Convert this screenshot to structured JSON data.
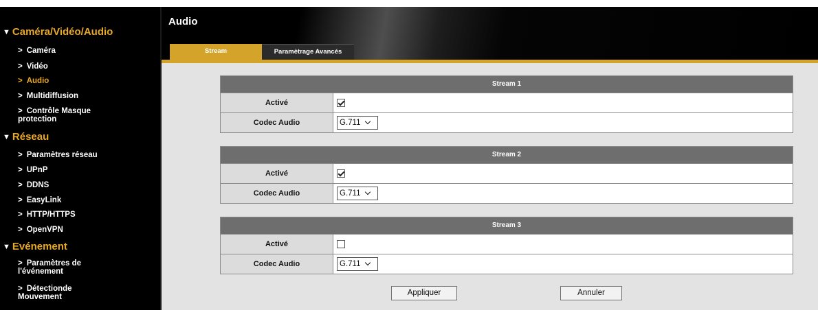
{
  "header": {
    "title": "Audio"
  },
  "tabs": [
    {
      "label": "Stream",
      "active": true
    },
    {
      "label": "Paramètrage Avancés",
      "active": false
    }
  ],
  "sidebar": {
    "sections": [
      {
        "label": "Caméra/Vidéo/Audio",
        "items": [
          "Caméra",
          "Vidéo",
          "Audio",
          "Multidiffusion",
          "Contrôle Masque protection"
        ]
      },
      {
        "label": "Réseau",
        "items": [
          "Paramètres réseau",
          "UPnP",
          "DDNS",
          "EasyLink",
          "HTTP/HTTPS",
          "OpenVPN"
        ]
      },
      {
        "label": "Evénement",
        "items": [
          "Paramètres de l'événement",
          "Détectionde Mouvement"
        ]
      }
    ],
    "active_item": "Audio"
  },
  "streams": [
    {
      "title": "Stream 1",
      "enabled_label": "Activé",
      "enabled": true,
      "codec_label": "Codec Audio",
      "codec_value": "G.711"
    },
    {
      "title": "Stream 2",
      "enabled_label": "Activé",
      "enabled": true,
      "codec_label": "Codec Audio",
      "codec_value": "G.711"
    },
    {
      "title": "Stream 3",
      "enabled_label": "Activé",
      "enabled": false,
      "codec_label": "Codec Audio",
      "codec_value": "G.711"
    }
  ],
  "buttons": {
    "apply": "Appliquer",
    "cancel": "Annuler"
  },
  "colors": {
    "accent": "#d4a32a",
    "sidebar_active": "#e8a824",
    "table_header": "#6e6e6e"
  }
}
